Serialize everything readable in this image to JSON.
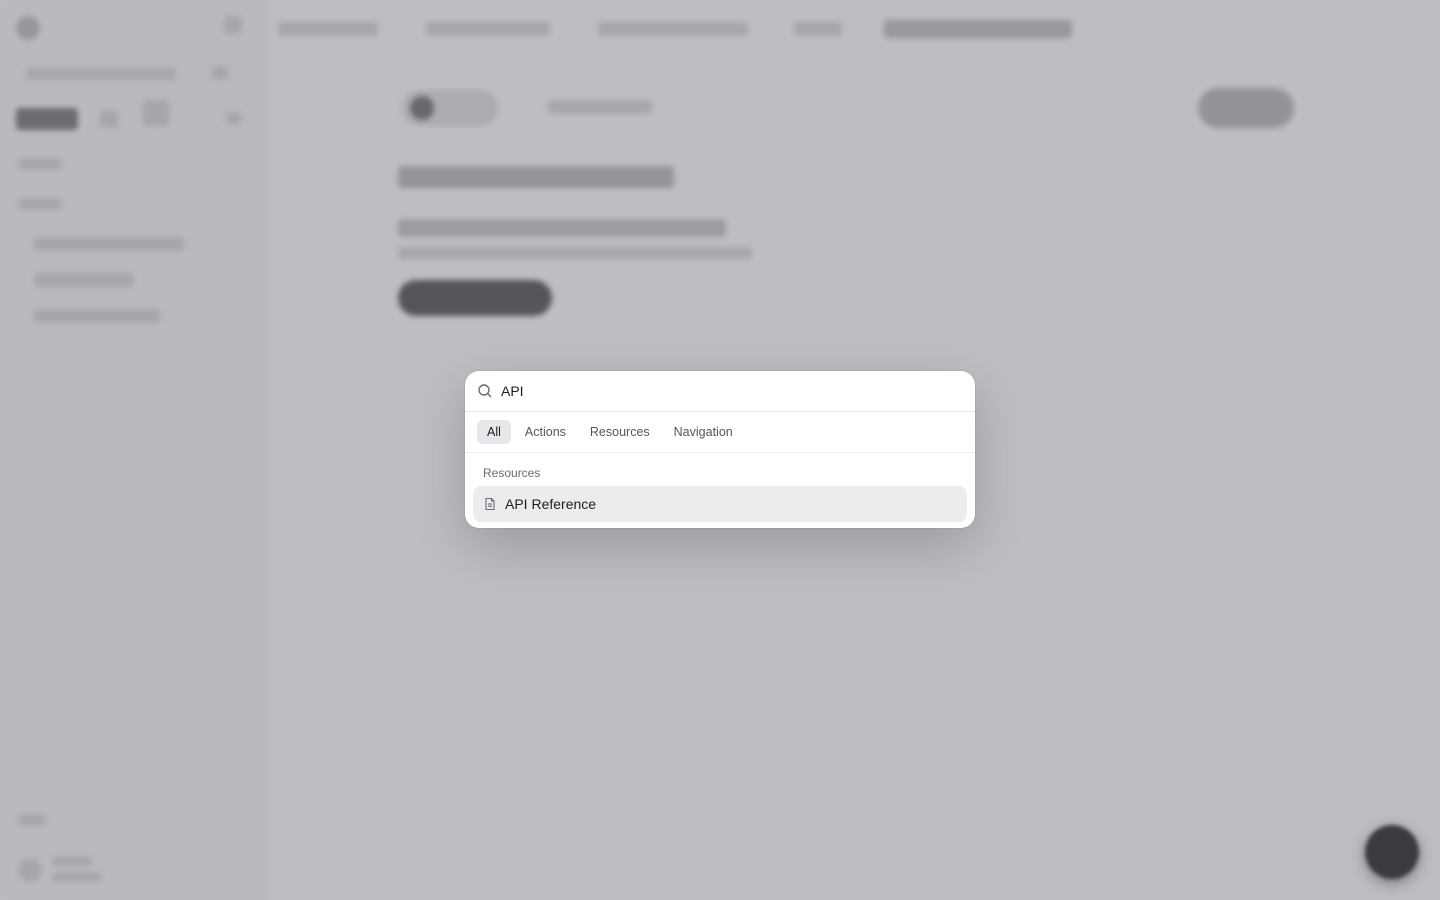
{
  "palette": {
    "search": {
      "value": "API",
      "icon": "search-icon"
    },
    "tabs": [
      {
        "label": "All",
        "active": true
      },
      {
        "label": "Actions",
        "active": false
      },
      {
        "label": "Resources",
        "active": false
      },
      {
        "label": "Navigation",
        "active": false
      }
    ],
    "sections": [
      {
        "label": "Resources",
        "items": [
          {
            "label": "API Reference",
            "icon": "document-icon",
            "selected": true
          }
        ]
      }
    ]
  },
  "colors": {
    "palette_bg": "#ffffff",
    "selected_item_bg": "#ececef",
    "active_tab_bg": "#e8e8ec",
    "overlay": "#bcbcc0"
  }
}
